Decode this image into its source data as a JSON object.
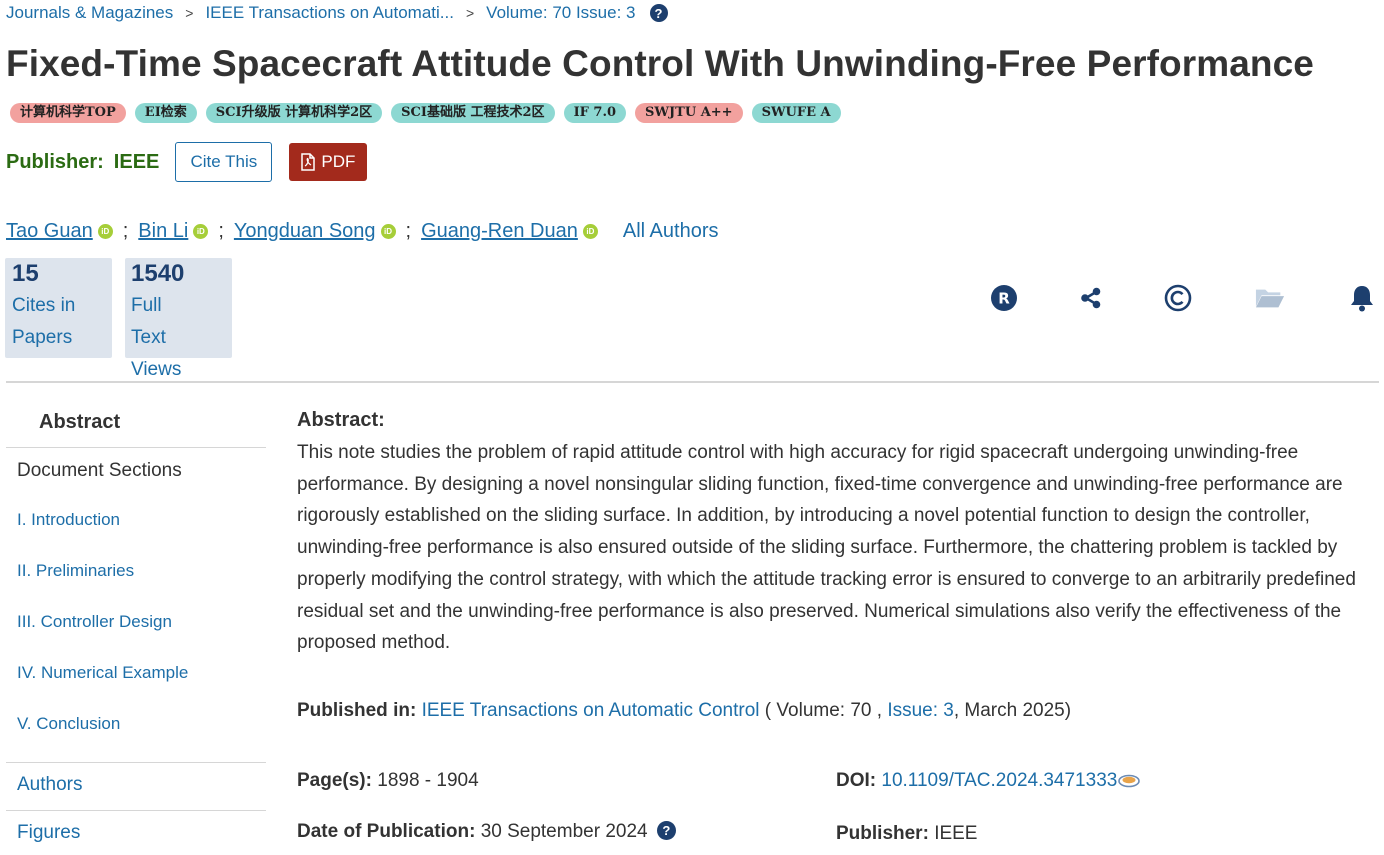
{
  "breadcrumb": {
    "items": [
      "Journals & Magazines",
      "IEEE Transactions on Automati...",
      "Volume: 70 Issue: 3"
    ],
    "separator": ">"
  },
  "article": {
    "title": "Fixed-Time Spacecraft Attitude Control With Unwinding-Free Performance"
  },
  "badges": [
    {
      "label": "计算机科学TOP",
      "color": "#f2a19e"
    },
    {
      "label": "EI检索",
      "color": "#8dd8d2"
    },
    {
      "label": "SCI升级版 计算机科学2区",
      "color": "#8dd8d2"
    },
    {
      "label": "SCI基础版 工程技术2区",
      "color": "#8dd8d2"
    },
    {
      "label": "IF 7.0",
      "color": "#8dd8d2"
    },
    {
      "label": "SWJTU A++",
      "color": "#f2a19e"
    },
    {
      "label": "SWUFE A",
      "color": "#8dd8d2"
    }
  ],
  "publisher_row": {
    "label": "Publisher:",
    "value": "IEEE",
    "cite_button": "Cite This",
    "pdf_button": "PDF"
  },
  "authors": {
    "list": [
      "Tao Guan",
      "Bin Li",
      "Yongduan Song",
      "Guang-Ren Duan"
    ],
    "separator": ";",
    "all_authors": "All Authors"
  },
  "metrics": {
    "cites": {
      "value": "15",
      "label_1": "Cites in",
      "label_2": "Papers"
    },
    "views": {
      "value": "1540",
      "label_1": "Full",
      "label_2": "Text",
      "label_3": "Views"
    }
  },
  "tools": [
    "rights-icon",
    "share-icon",
    "copyright-icon",
    "folder-icon",
    "alert-bell-icon"
  ],
  "sidebar": {
    "abstract": "Abstract",
    "document_sections": "Document Sections",
    "sections": [
      "I.  Introduction",
      "II.  Preliminaries",
      "III.  Controller Design",
      "IV.  Numerical Example",
      "V.  Conclusion"
    ],
    "authors": "Authors",
    "figures": "Figures"
  },
  "abstract": {
    "heading": "Abstract:",
    "text": "This note studies the problem of rapid attitude control with high accuracy for rigid spacecraft undergoing unwinding-free performance. By designing a novel nonsingular sliding function, fixed-time convergence and unwinding-free performance are rigorously established on the sliding surface. In addition, by introducing a novel potential function to design the controller, unwinding-free performance is also ensured outside of the sliding surface. Furthermore, the chattering problem is tackled by properly modifying the control strategy, with which the attitude tracking error is ensured to converge to an arbitrarily predefined residual set and the unwinding-free performance is also preserved. Numerical simulations also verify the effectiveness of the proposed method."
  },
  "details": {
    "published_in_label": "Published in:",
    "journal": "IEEE Transactions on Automatic Control",
    "volume_text": "( Volume: 70 ,",
    "issue_link": "Issue: 3",
    "date_text": ", March 2025)",
    "pages_label": "Page(s):",
    "pages": "1898 - 1904",
    "doi_label": "DOI:",
    "doi": "10.1109/TAC.2024.3471333",
    "date_pub_label": "Date of Publication:",
    "date_pub": "30 September 2024",
    "publisher_label": "Publisher:",
    "publisher": "IEEE"
  },
  "colors": {
    "link": "#1d6ea8",
    "navy": "#1d3f6e",
    "publisher_green": "#2b6b13",
    "pdf_red": "#a32a1c",
    "metric_bg": "#dde4ed"
  }
}
